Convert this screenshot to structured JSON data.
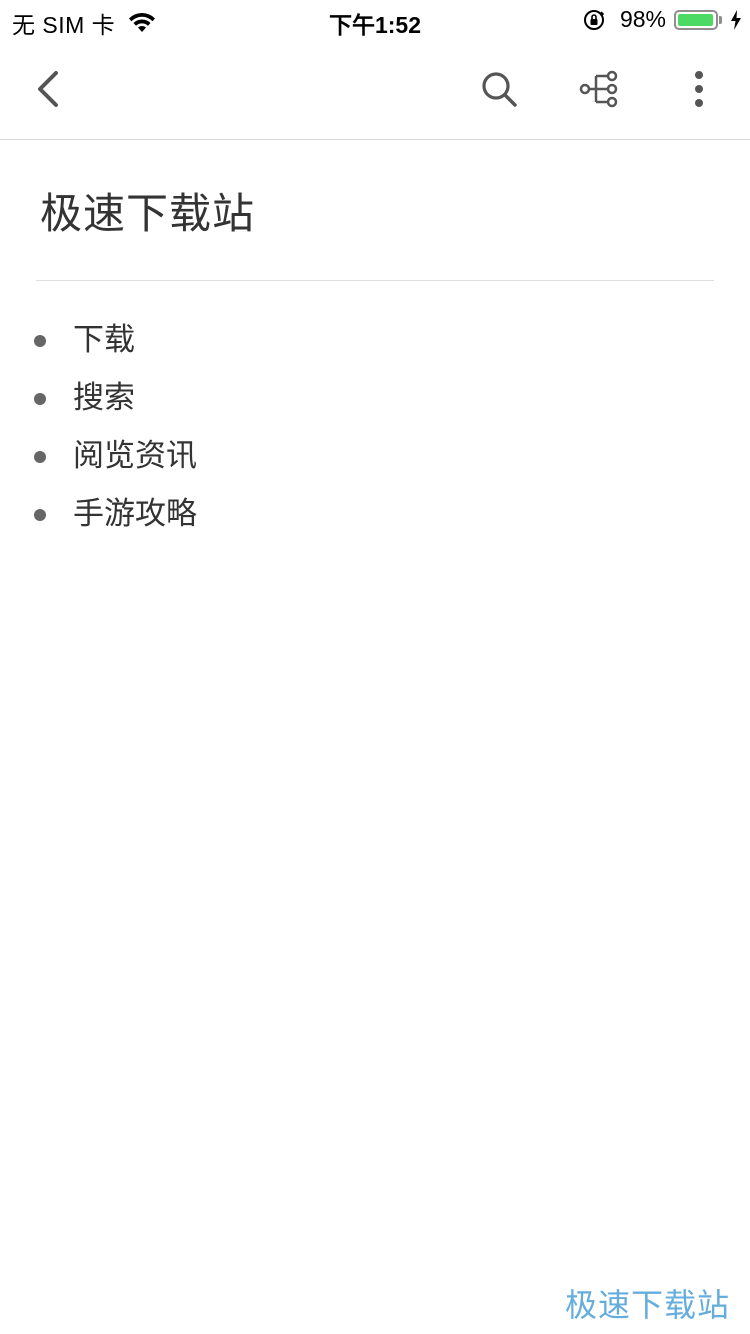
{
  "status_bar": {
    "carrier": "无 SIM 卡",
    "time": "下午1:52",
    "battery_percent": "98%",
    "battery_level": 0.98,
    "icons": [
      "wifi-icon",
      "orientation-lock-icon",
      "battery-icon",
      "charging-bolt-icon"
    ]
  },
  "nav": {
    "icons": [
      "back-chevron-icon",
      "search-icon",
      "mind-map-icon",
      "more-vertical-icon"
    ]
  },
  "document": {
    "title": "极速下载站",
    "items": [
      {
        "label": "下载"
      },
      {
        "label": "搜索"
      },
      {
        "label": "阅览资讯"
      },
      {
        "label": "手游攻略"
      }
    ]
  },
  "watermark": "极速下载站",
  "colors": {
    "battery_fill": "#4cd964",
    "text": "#333333",
    "icon": "#666666",
    "watermark": "#4a9fd8"
  }
}
